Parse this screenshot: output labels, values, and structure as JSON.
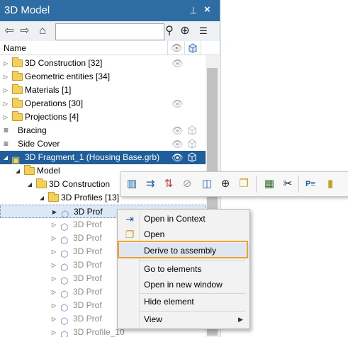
{
  "panel": {
    "title": "3D Model",
    "pin_glyph": "⊥",
    "close_glyph": "×",
    "column_name": "Name"
  },
  "toolbar": {
    "back_icon": "⇦",
    "forward_icon": "⇨",
    "home_icon": "⌂",
    "search_value": "",
    "find_icon": "⚲",
    "target_icon": "⊕",
    "list_icon": "☰"
  },
  "tree": [
    {
      "label": "3D Construction [32]",
      "kind": "folder",
      "eye": true
    },
    {
      "label": "Geometric entities [34]",
      "kind": "folder",
      "eye": false
    },
    {
      "label": "Materials [1]",
      "kind": "folder",
      "eye": false
    },
    {
      "label": "Operations [30]",
      "kind": "folder",
      "eye": true
    },
    {
      "label": "Projections [4]",
      "kind": "folder",
      "eye": false
    },
    {
      "label": "Bracing",
      "kind": "body",
      "eye": true
    },
    {
      "label": "Side Cover",
      "kind": "body",
      "eye": true
    },
    {
      "label": "3D Fragment_1 (Housing Base.grb)",
      "kind": "fragment",
      "eye": true,
      "selected": true
    },
    {
      "label": "Model",
      "kind": "folder"
    },
    {
      "label": "3D Construction",
      "kind": "folder"
    },
    {
      "label": "3D Profiles [13]",
      "kind": "folder"
    },
    {
      "label": "3D Prof",
      "kind": "profile"
    },
    {
      "label": "3D Prof",
      "kind": "profile"
    },
    {
      "label": "3D Prof",
      "kind": "profile"
    },
    {
      "label": "3D Prof",
      "kind": "profile"
    },
    {
      "label": "3D Prof",
      "kind": "profile"
    },
    {
      "label": "3D Prof",
      "kind": "profile"
    },
    {
      "label": "3D Prof",
      "kind": "profile"
    },
    {
      "label": "3D Prof",
      "kind": "profile"
    },
    {
      "label": "3D Prof",
      "kind": "profile"
    },
    {
      "label": "3D Profile_10",
      "kind": "profile"
    }
  ],
  "mini_toolbar": {
    "icons": [
      "assembly-icon",
      "derive-icon",
      "fragment-link-icon",
      "hide-icon",
      "cube-icon",
      "target-icon",
      "folder-refresh-icon",
      "calculator-icon",
      "scissors-icon",
      "param-icon",
      "ruler-icon"
    ]
  },
  "context_menu": {
    "items": [
      {
        "label": "Open in Context"
      },
      {
        "label": "Open"
      },
      {
        "label": "Derive to assembly"
      },
      {
        "label": "Go to elements"
      },
      {
        "label": "Open in new window"
      },
      {
        "label": "Hide element"
      },
      {
        "label": "View"
      }
    ]
  },
  "colors": {
    "titlebar": "#2e6da4",
    "selection": "#1f5e9a",
    "focus_outline": "#f0a030"
  }
}
